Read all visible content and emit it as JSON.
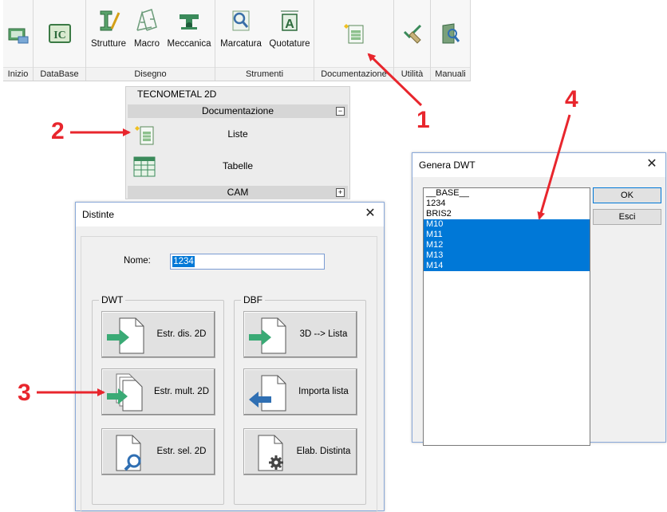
{
  "ribbon": {
    "groups": [
      {
        "label": "Inizio"
      },
      {
        "label": "DataBase"
      },
      {
        "label": "Disegno"
      },
      {
        "label": "Strumenti"
      },
      {
        "label": "Documentazione"
      },
      {
        "label": "Utilità"
      },
      {
        "label": "Manuali"
      }
    ],
    "buttons": {
      "strutture": "Strutture",
      "macro": "Macro",
      "meccanica": "Meccanica",
      "marcatura": "Marcatura",
      "quotature": "Quotature"
    },
    "icons": [
      "home-icon",
      "database-icon",
      "strutture-icon",
      "macro-icon",
      "meccanica-icon",
      "marcatura-icon",
      "quotature-icon",
      "documentazione-icon",
      "utilita-icon",
      "manuali-icon"
    ]
  },
  "panel": {
    "title": "TECNOMETAL 2D",
    "section_documentazione": "Documentazione",
    "item_liste": "Liste",
    "item_tabelle": "Tabelle",
    "section_cam": "CAM",
    "minus": "−",
    "plus": "+"
  },
  "distinte": {
    "title": "Distinte",
    "close": "✕",
    "nome_label": "Nome:",
    "nome_value": "1234",
    "dwt_legend": "DWT",
    "dbf_legend": "DBF",
    "btn_estr_dis": "Estr. dis. 2D",
    "btn_estr_mult": "Estr. mult. 2D",
    "btn_estr_sel": "Estr. sel. 2D",
    "btn_3d_lista": "3D --> Lista",
    "btn_importa": "Importa lista",
    "btn_elab": "Elab. Distinta"
  },
  "genera": {
    "title": "Genera DWT",
    "close": "✕",
    "items": [
      {
        "text": "__BASE__",
        "selected": false
      },
      {
        "text": "1234",
        "selected": false
      },
      {
        "text": "BRIS2",
        "selected": false
      },
      {
        "text": "M10",
        "selected": true
      },
      {
        "text": "M11",
        "selected": true
      },
      {
        "text": "M12",
        "selected": true
      },
      {
        "text": "M13",
        "selected": true
      },
      {
        "text": "M14",
        "selected": true
      }
    ],
    "ok": "OK",
    "esci": "Esci"
  },
  "callouts": {
    "c1": "1",
    "c2": "2",
    "c3": "3",
    "c4": "4"
  },
  "colors": {
    "accent": "#0078d7",
    "arrow": "#e8262d",
    "green": "#3aaa75",
    "blue": "#2f6fb3"
  }
}
